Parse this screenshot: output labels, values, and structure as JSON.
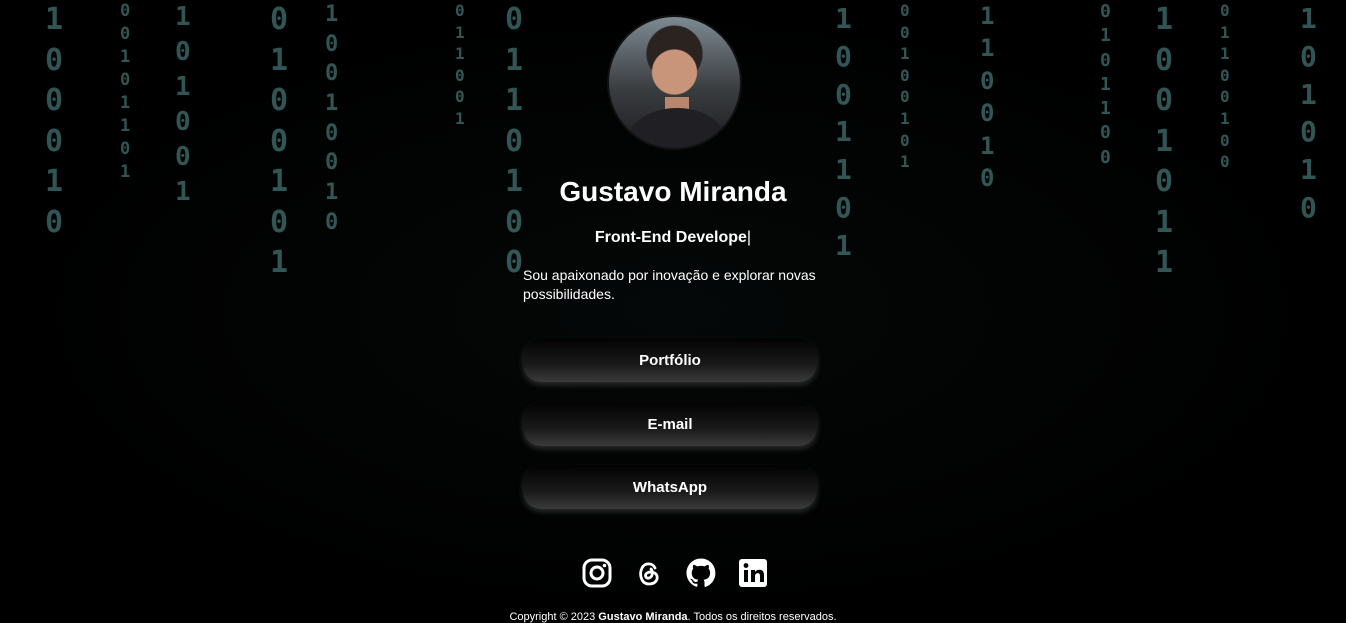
{
  "profile": {
    "name": "Gustavo Miranda",
    "role": "Front-End Develope",
    "cursor": "|",
    "bio": "Sou apaixonado por inovação e explorar novas possibilidades."
  },
  "links": {
    "portfolio": "Portfólio",
    "email": "E-mail",
    "whatsapp": "WhatsApp"
  },
  "socials": [
    {
      "icon": "instagram-icon"
    },
    {
      "icon": "threads-icon"
    },
    {
      "icon": "github-icon"
    },
    {
      "icon": "linkedin-icon"
    }
  ],
  "footer": {
    "prefix": "Copyright © 2023 ",
    "owner": "Gustavo Miranda",
    "suffix": ". Todos os direitos reservados."
  },
  "background": {
    "columns": [
      "1\n0\n0\n0\n1\n0",
      "0\n0\n1\n0\n1\n1\n0\n1",
      "1\n0\n1\n0\n0\n1",
      "0\n1\n0\n0\n1\n0\n1",
      "1\n0\n0\n1\n0\n0\n1\n0",
      "0\n1\n1\n0\n0\n1",
      "0\n1\n1\n0\n1\n0\n0",
      "1\n0\n0\n1\n1\n0\n1",
      "0\n0\n1\n0\n0\n1\n0\n1",
      "1\n1\n0\n0\n1\n0",
      "0\n1\n0\n1\n1\n0\n0",
      "1\n0\n0\n1\n0\n1\n1",
      "0\n1\n1\n0\n0\n1\n0\n0",
      "1\n0\n1\n0\n1\n0"
    ],
    "color": "#5a9a9a"
  }
}
